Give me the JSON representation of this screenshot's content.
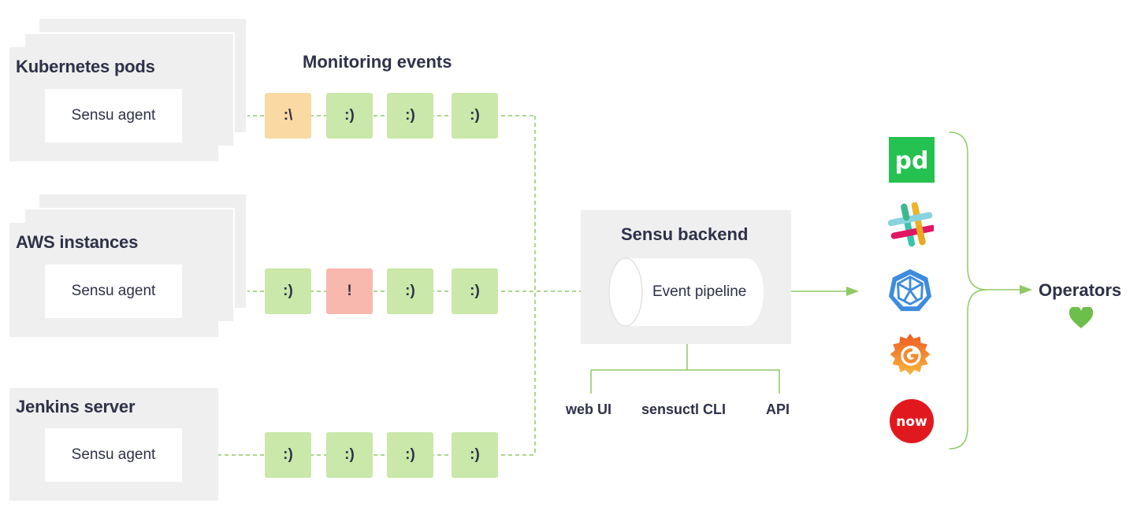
{
  "groups": [
    {
      "title": "Kubernetes pods",
      "agent": "Sensu agent"
    },
    {
      "title": "AWS instances",
      "agent": "Sensu agent"
    },
    {
      "title": "Jenkins server",
      "agent": "Sensu agent"
    }
  ],
  "events_heading": "Monitoring events",
  "event_rows": [
    [
      {
        "label": ":\\",
        "status": "warning"
      },
      {
        "label": ":)",
        "status": "ok"
      },
      {
        "label": ":)",
        "status": "ok"
      },
      {
        "label": ":)",
        "status": "ok"
      }
    ],
    [
      {
        "label": ":)",
        "status": "ok"
      },
      {
        "label": "!",
        "status": "critical"
      },
      {
        "label": ":)",
        "status": "ok"
      },
      {
        "label": ":)",
        "status": "ok"
      }
    ],
    [
      {
        "label": ":)",
        "status": "ok"
      },
      {
        "label": ":)",
        "status": "ok"
      },
      {
        "label": ":)",
        "status": "ok"
      },
      {
        "label": ":)",
        "status": "ok"
      }
    ]
  ],
  "backend": {
    "title": "Sensu backend",
    "pipeline": "Event pipeline",
    "interfaces": [
      "web UI",
      "sensuctl CLI",
      "API"
    ]
  },
  "integrations": [
    {
      "icon": "pagerduty-icon",
      "text": "pd"
    },
    {
      "icon": "slack-icon"
    },
    {
      "icon": "kubernetes-icon"
    },
    {
      "icon": "grafana-icon"
    },
    {
      "icon": "servicenow-icon",
      "text": "now"
    }
  ],
  "operators": {
    "label": "Operators",
    "icon": "heart-icon"
  },
  "colors": {
    "ok": "#c9e8a9",
    "warning": "#fbd9a3",
    "critical": "#f9b8ad",
    "line": "#8fc966",
    "panel": "#efefef",
    "text": "#2e3148",
    "pagerduty": "#25c151",
    "servicenow": "#e1191e",
    "heart": "#6dbf4b"
  }
}
